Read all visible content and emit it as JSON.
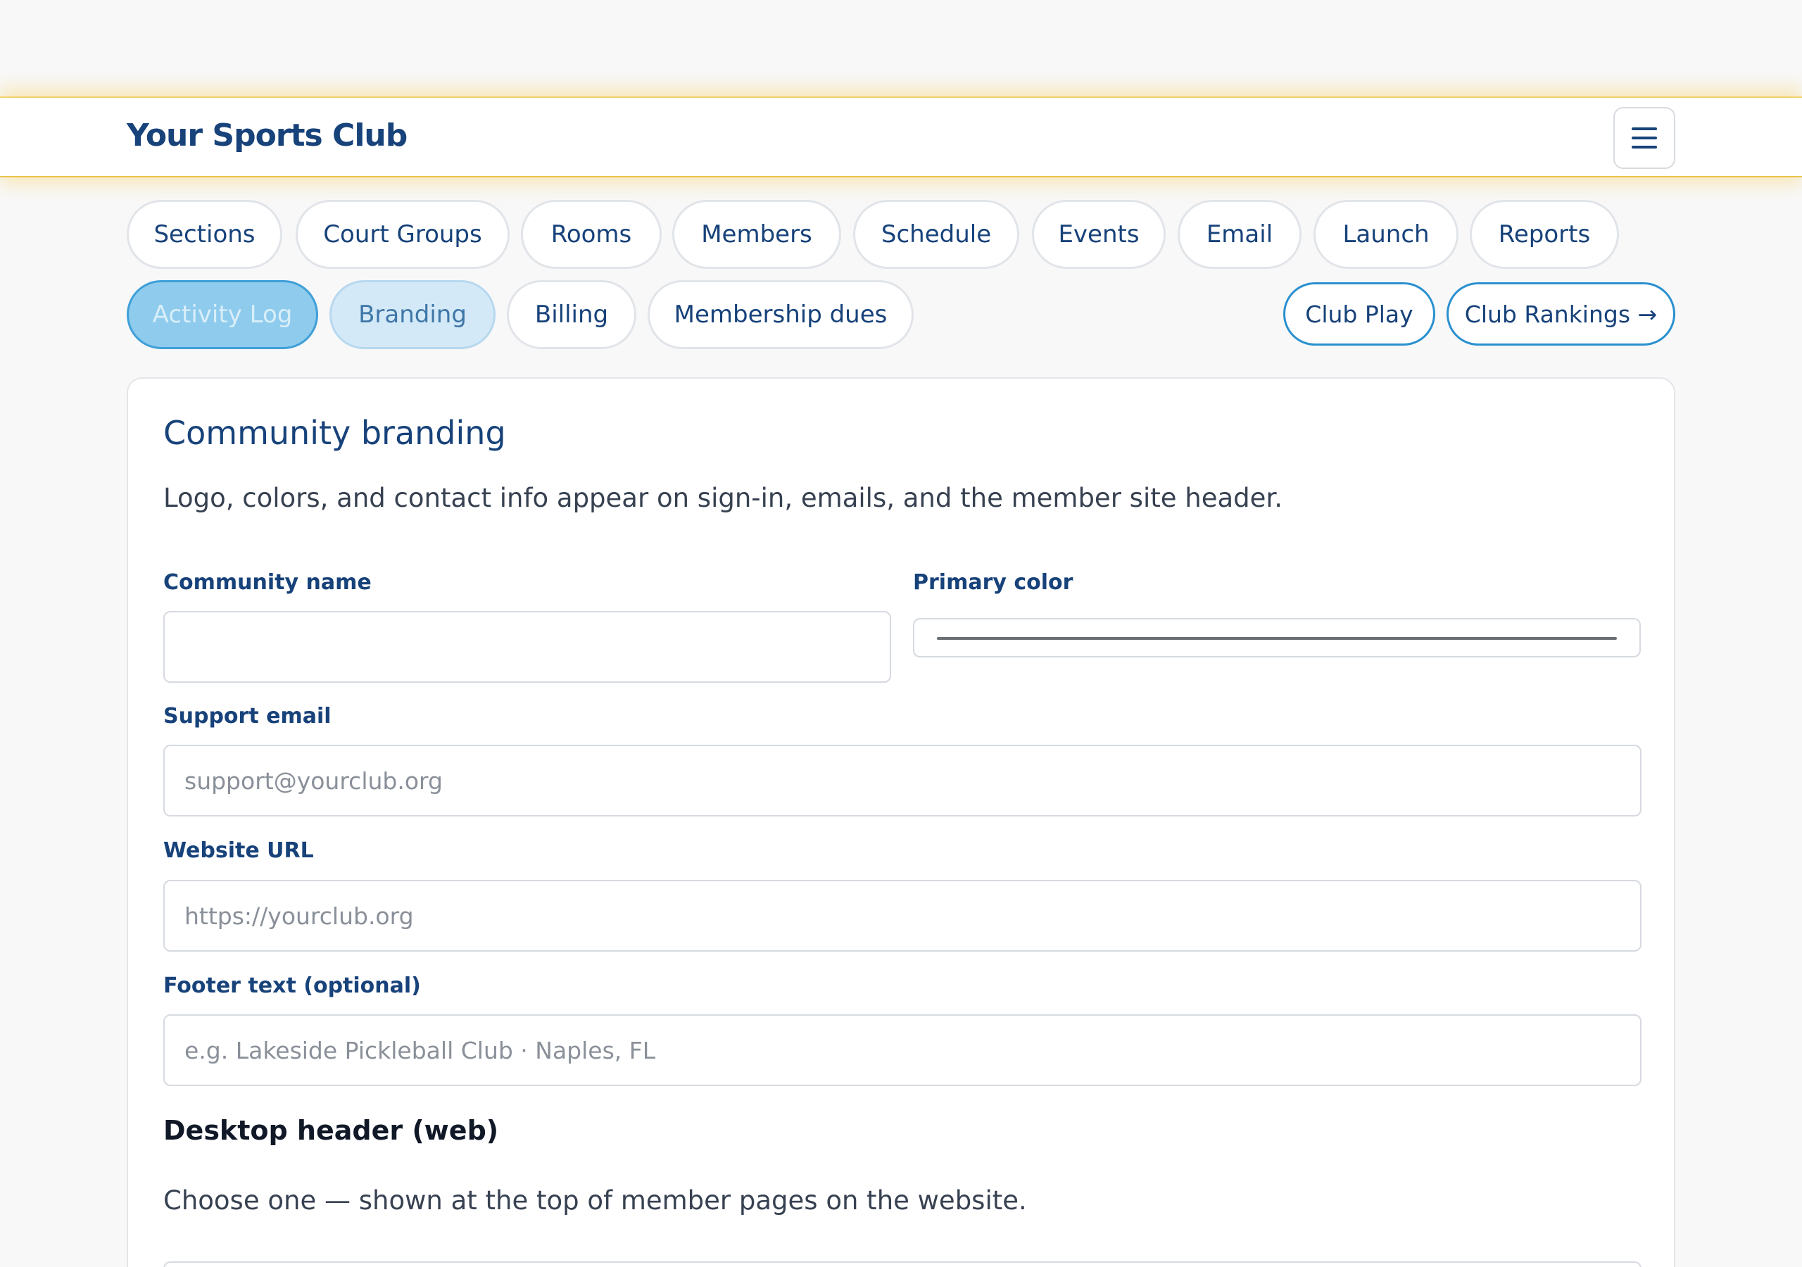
{
  "app": {
    "brand": "Your Sports Club",
    "menu_icon": "hamburger-icon"
  },
  "nav": {
    "row1": [
      {
        "label": "Sections"
      },
      {
        "label": "Court Groups"
      },
      {
        "label": "Rooms"
      },
      {
        "label": "Members"
      },
      {
        "label": "Schedule"
      },
      {
        "label": "Events"
      },
      {
        "label": "Email"
      },
      {
        "label": "Launch"
      },
      {
        "label": "Reports"
      }
    ],
    "row2": [
      {
        "label": "Activity Log"
      },
      {
        "label": "Branding"
      },
      {
        "label": "Billing"
      },
      {
        "label": "Membership dues"
      }
    ],
    "club_play": "Club Play",
    "club_rankings": "Club Rankings →"
  },
  "branding": {
    "title": "Community branding",
    "description": "Logo, colors, and contact info appear on sign-in, emails, and the member site header.",
    "community_name": {
      "label": "Community name",
      "value": ""
    },
    "primary_color": {
      "label": "Primary color"
    },
    "support_email": {
      "label": "Support email",
      "placeholder": "support@yourclub.org",
      "value": ""
    },
    "website_url": {
      "label": "Website URL",
      "placeholder": "https://yourclub.org",
      "value": ""
    },
    "footer_text": {
      "label": "Footer text (optional)",
      "placeholder": "e.g. Lakeside Pickleball Club · Naples, FL",
      "value": ""
    },
    "desktop_header": {
      "title": "Desktop header (web)",
      "description": "Choose one — shown at the top of member pages on the website."
    }
  },
  "colors": {
    "brand_navy": "#17427a",
    "accent_blue": "#2a90cf",
    "active_tab_bg": "#8ecbed",
    "header_glow": "#e9c44a"
  }
}
